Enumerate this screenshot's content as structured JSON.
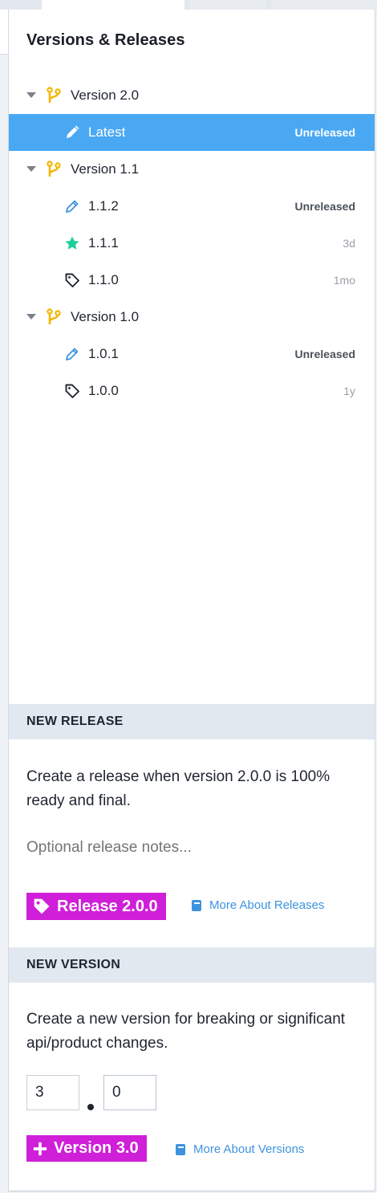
{
  "panel": {
    "title": "Versions & Releases"
  },
  "colors": {
    "accent_blue": "#4aa8f3",
    "branch_yellow": "#f2b705",
    "star_teal": "#1fcf9b",
    "button_magenta": "#cf1fd8",
    "link_blue": "#3d93e0"
  },
  "versions": [
    {
      "label": "Version 2.0",
      "items": [
        {
          "label": "Latest",
          "meta": "Unreleased",
          "icon": "pencil-icon",
          "selected": true
        }
      ]
    },
    {
      "label": "Version 1.1",
      "items": [
        {
          "label": "1.1.2",
          "meta": "Unreleased",
          "icon": "pencil-icon"
        },
        {
          "label": "1.1.1",
          "meta": "3d",
          "icon": "star-icon"
        },
        {
          "label": "1.1.0",
          "meta": "1mo",
          "icon": "tag-icon"
        }
      ]
    },
    {
      "label": "Version 1.0",
      "items": [
        {
          "label": "1.0.1",
          "meta": "Unreleased",
          "icon": "pencil-icon"
        },
        {
          "label": "1.0.0",
          "meta": "1y",
          "icon": "tag-icon"
        }
      ]
    }
  ],
  "new_release": {
    "heading": "NEW RELEASE",
    "description": "Create a release when version 2.0.0 is 100% ready and final.",
    "notes_placeholder": "Optional release notes...",
    "button_label": "Release 2.0.0",
    "link_label": "More About Releases"
  },
  "new_version": {
    "heading": "NEW VERSION",
    "description": "Create a new version for breaking or significant api/product changes.",
    "major": "3",
    "minor": "0",
    "button_label": "Version 3.0",
    "link_label": "More About Versions"
  }
}
